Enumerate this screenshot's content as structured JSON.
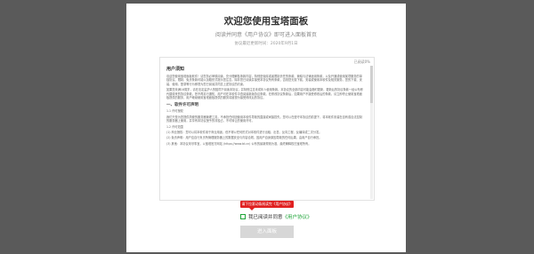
{
  "modal": {
    "title": "欢迎您使用宝塔面板",
    "subtitle": "阅读并同意《用户协议》即可进入面板首页",
    "updated": "协议最近更新时间：2020年9月1日"
  },
  "document": {
    "progress": "已阅读0%",
    "heading": "用户须知",
    "paragraphs": [
      "欢迎您使用宝塔面板软件！请您务必审慎阅读、充分理解各条款内容，特别是免除或者限制责任的条款、管辖与法律适用条款，以及开通或使用某项服务的单独协议。限制、免责条款可能以加粗形式提示您注意。除非您已阅读并接受本协议所有条款，否则您无权下载、安装或使用本软件及相关服务。您的下载、安装、使用、登录等行为即视为您已阅读并同意上述协议的约束。",
      "如果您未满18周岁，请在法定监护人的陪同下阅读本协议，并特别注意未成年人使用条款。本协议的全部内容可能会随时更新，更新后的协议条款一经公布即代替原来的协议条款，恕不再另行通知，用户可在本软件中查阅最新版协议条款。在修改协议条款后，如果用户不接受修改后的条款，请立即停止使用宝塔面板提供的服务，用户继续使用宝塔面板提供的服务将被视为接受修改后的协议。"
    ],
    "section_title": "一、软件许可声明",
    "section_paragraphs": [
      "1.1 许可授权",
      "我们只是为您提供简便的服务器管理工具，不承担任何因使用本软件导致的直接或间接损失。您可以在遵守本协议的前提下，将本软件安装在自有或合法控制的服务器上使用，并享有本协议授予的非独占、不可转让的使用许可。",
      "1.2 许可范围",
      "(1) 商业授权：您可以将本软件用于商业用途，但不得以任何形式对本软件进行出租、出售、反向工程、反编译或二次分发。",
      "(2) 免责声明：用户应自行负责所管理服务器上的数据安全与内容合规，因用户自身原因导致的任何后果，由用户自行承担。",
      "(3) 其他：本协议未尽事宜，以宝塔官方网站 (https://www.bt.cn) 公布的最新规则为准，最终解释权归宝塔所有。"
    ]
  },
  "tooltip": "请下拉滚动条阅读完《用户协议》",
  "agree": {
    "prefix": "我已阅读并同意",
    "link": "《用户协议》"
  },
  "enter_button": "进入面板",
  "colors": {
    "accent": "#20a53a",
    "tooltip": "#e02020",
    "button_disabled": "#d7d7d7",
    "overlay": "#5a5a5a"
  }
}
